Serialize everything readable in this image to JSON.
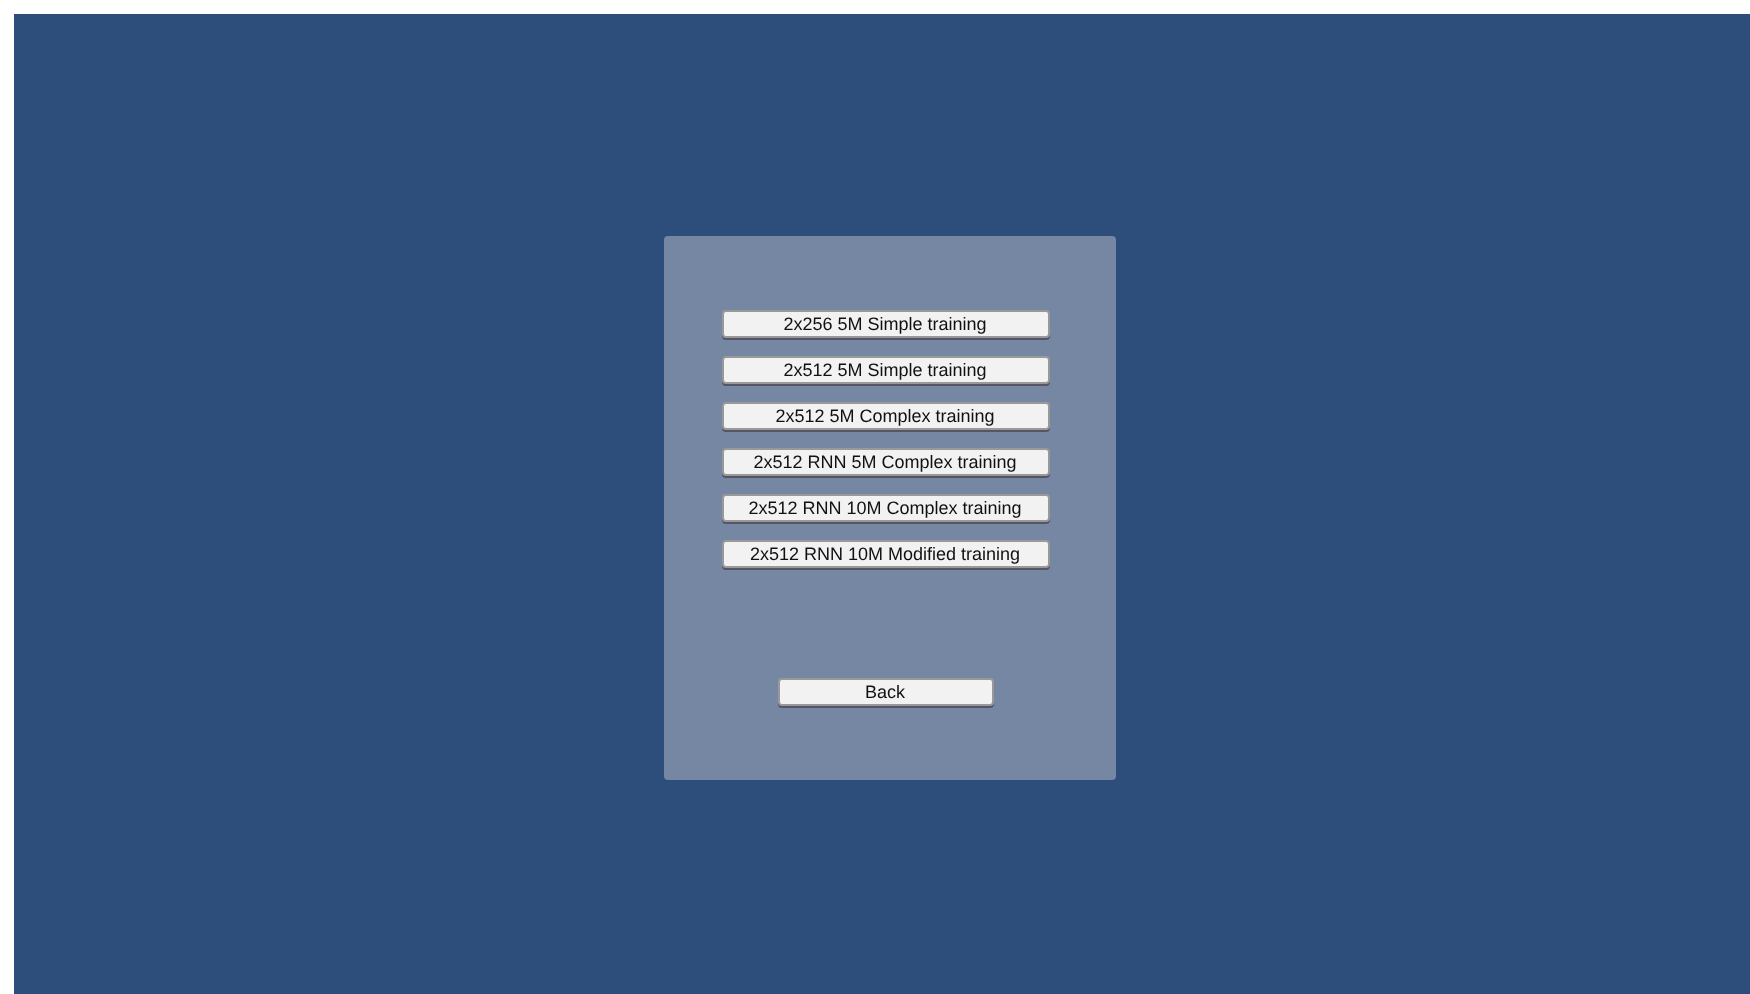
{
  "menu_buttons": [
    {
      "label": "2x256 5M Simple training"
    },
    {
      "label": "2x512 5M Simple training"
    },
    {
      "label": "2x512 5M Complex training"
    },
    {
      "label": "2x512 RNN 5M Complex training"
    },
    {
      "label": "2x512 RNN 10M Complex training"
    },
    {
      "label": "2x512 RNN 10M Modified training"
    }
  ],
  "back_button": {
    "label": "Back"
  }
}
